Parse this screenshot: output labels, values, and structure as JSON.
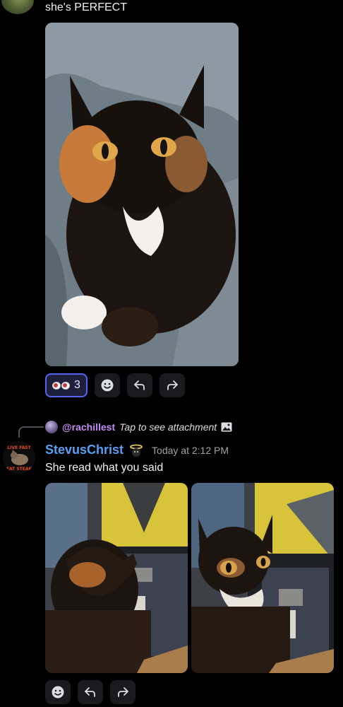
{
  "message1": {
    "text": "she's PERFECT"
  },
  "message1_reactions": {
    "emoji_name": "eyes-emoji",
    "count": "3"
  },
  "reply": {
    "username": "@rachillest",
    "text": "Tap to see attachment"
  },
  "message2": {
    "avatar_text_top": "LIVE FAST",
    "avatar_text_bottom": "EAT STEAK",
    "username": "StevusChrist",
    "timestamp": "Today at 2:12 PM",
    "text": "She read what you said"
  },
  "icons": {
    "add_reaction": "smiley-icon",
    "reply": "reply-arrow-icon",
    "forward": "forward-arrow-icon",
    "attachment": "image-icon"
  },
  "colors": {
    "background": "#000000",
    "username": "#5aa0f2",
    "reply_username": "#c38cf2",
    "reaction_border": "#5865f2"
  }
}
